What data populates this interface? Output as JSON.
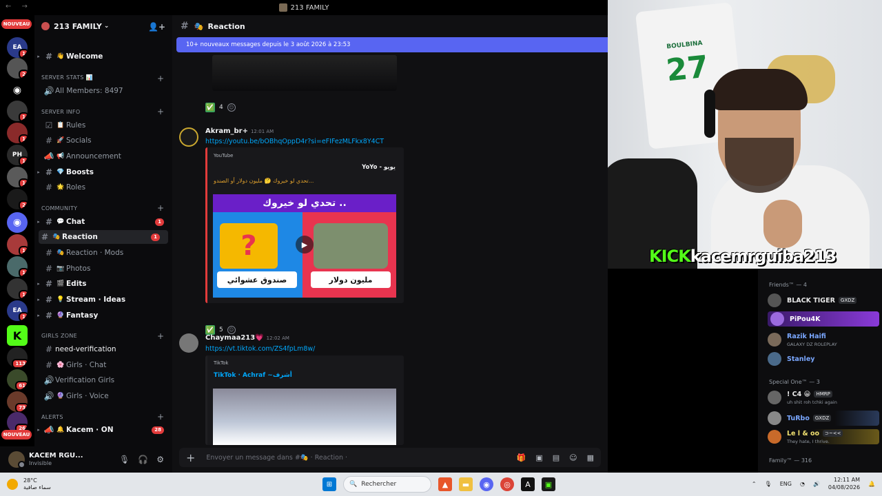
{
  "window": {
    "title": "213 FAMILY"
  },
  "rail": {
    "nouveau_top": "NOUVEAU",
    "nouveau_bottom": "NOUVEAU",
    "badges": [
      "1",
      "2",
      "1",
      "1",
      "1",
      "1",
      "4",
      "2",
      "1",
      "1",
      "1",
      "1",
      "1",
      "1",
      "113",
      "61",
      "73",
      "26"
    ]
  },
  "guild": {
    "name": "213 FAMILY"
  },
  "sidebar": {
    "top_channels": [
      {
        "emoji": "👋",
        "name": "Welcome"
      }
    ],
    "server_stats": {
      "label": "SERVER STATS 📊",
      "members": "All Members: 8497"
    },
    "server_info": {
      "label": "SERVER INFO",
      "channels": [
        {
          "name": "Rules",
          "emoji": "📋"
        },
        {
          "name": "Socials",
          "emoji": "🚀"
        },
        {
          "name": "Announcement",
          "emoji": "📢"
        },
        {
          "name": "Boosts",
          "emoji": "💎"
        },
        {
          "name": "Roles",
          "emoji": "🌟"
        }
      ]
    },
    "community": {
      "label": "COMMUNITY",
      "channels": [
        {
          "name": "Chat",
          "emoji": "💬",
          "count": "1",
          "bold": true
        },
        {
          "name": "Reaction",
          "emoji": "🎭",
          "count": "1",
          "bold": true,
          "selected": true
        },
        {
          "name": "Reaction · Mods",
          "emoji": "🎭"
        },
        {
          "name": "Photos",
          "emoji": "📷"
        },
        {
          "name": "Edits",
          "emoji": "🎬",
          "bold": true
        },
        {
          "name": "Stream · Ideas",
          "emoji": "💡",
          "bold": true
        },
        {
          "name": "Fantasy",
          "emoji": "🔮",
          "bold": true
        }
      ]
    },
    "girls_zone": {
      "label": "GIRLS ZONE",
      "channels": [
        {
          "name": "need-verification",
          "emoji": ""
        },
        {
          "name": "Girls · Chat",
          "emoji": "🌸"
        },
        {
          "name": "Verification Girls",
          "emoji": ""
        },
        {
          "name": "Girls · Voice",
          "emoji": "🔮"
        }
      ]
    },
    "alerts": {
      "label": "ALERTS",
      "channels": [
        {
          "name": "Kacem · ON",
          "emoji": "🔔",
          "count": "28",
          "bold": true
        }
      ]
    }
  },
  "user": {
    "name": "KACEM RGU...",
    "status": "Invisible",
    "badge": "213"
  },
  "channel": {
    "name": "Reaction",
    "new_messages": "10+ nouveaux messages depuis le 3 août 2026 à 23:53"
  },
  "messages": [
    {
      "reactions": [
        {
          "emoji": "✅",
          "count": "4"
        }
      ]
    },
    {
      "author": "Akram_br+",
      "time": "12:01 AM",
      "link": "https://youtu.be/bOBhqOppD4r?si=eFIFezMLFkx8Y4CT",
      "provider": "YouTube",
      "title": "YoYo - يويو",
      "desc": "تحدي لو خيروك 🤔 مليون دولار أو الصندو...",
      "thumb_title": "تحدي لو خيروك ..",
      "thumb_left": "صندوق عشوائي",
      "thumb_right": "مليون دولار",
      "reactions": [
        {
          "emoji": "✅",
          "count": "5"
        }
      ]
    },
    {
      "author": "Chaymaa213💗",
      "time": "12:02 AM",
      "link": "https://vt.tiktok.com/ZS4fpLm8w/",
      "provider": "TikTok",
      "title": "TikTok · Achraf ~أشرف"
    }
  ],
  "composer": {
    "placeholder": "Envoyer un message dans #🎭 · Reaction ·"
  },
  "stream": {
    "brand_kick": "KICK",
    "brand_user": "kacemrguiba213",
    "jersey_name": "BOULBINA",
    "jersey_number": "27"
  },
  "members": {
    "friends": {
      "label": "Friends™ — 4",
      "list": [
        {
          "name": "BLACK TIGER",
          "tag": "GXDZ",
          "color": "#e8e8e8"
        },
        {
          "name": "PiPou4K",
          "color": "#ffffff"
        },
        {
          "name": "Razik Haifi",
          "sub": "GALAXY DZ ROLEPLAY",
          "color": "#7aa7ff"
        },
        {
          "name": "Stanley",
          "color": "#7aa7ff"
        }
      ]
    },
    "special": {
      "label": "Special One™ — 3",
      "list": [
        {
          "name": "! C4 😀",
          "tag": "HMRP",
          "sub": "uh shit roh tchki again",
          "color": "#e8e8e8"
        },
        {
          "name": "TuRbo",
          "tag": "GXDZ",
          "color": "#7aa7ff"
        },
        {
          "name": "Le l & oo",
          "tag": "⊃~<<",
          "sub": "They hate, I thrive.",
          "color": "#f0e070"
        }
      ]
    },
    "family": {
      "label": "Family™ — 316"
    }
  },
  "taskbar": {
    "temp": "28°C",
    "weather": "سماء صافية",
    "search": "Rechercher",
    "lang": "ENG",
    "time": "12:11 AM",
    "date": "04/08/2026"
  },
  "colors": {
    "accent": "#5865f2",
    "kick": "#53fc18",
    "badge": "#e23b3b",
    "link": "#00a8fc"
  }
}
